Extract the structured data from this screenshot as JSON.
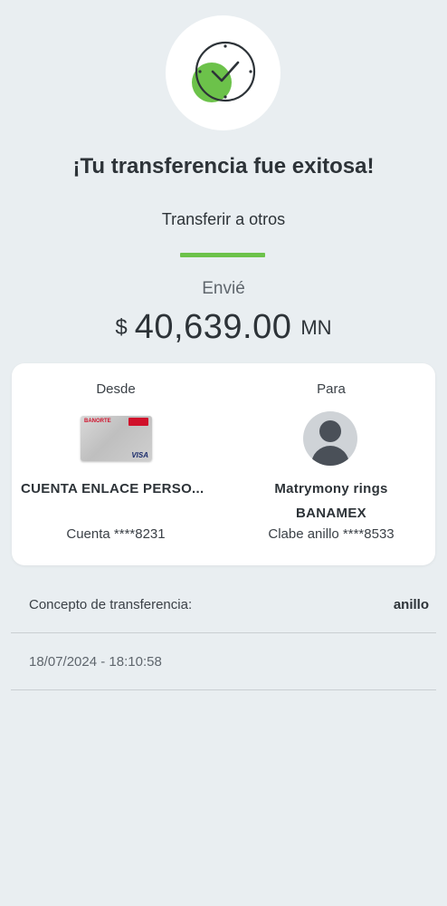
{
  "header": {
    "title": "¡Tu transferencia fue exitosa!",
    "subtitle": "Transferir a otros",
    "status_icon": "clock-check-icon",
    "accent_color": "#6cc24a"
  },
  "amount": {
    "label": "Envié",
    "currency_symbol": "$",
    "value": "40,639.00",
    "unit": "MN"
  },
  "from": {
    "heading": "Desde",
    "card_brand": "BANORTE",
    "card_network": "VISA",
    "account_name": "CUENTA ENLACE PERSO...",
    "account_number": "Cuenta ****8231"
  },
  "to": {
    "heading": "Para",
    "avatar_icon": "user-avatar-icon",
    "name": "Matrymony rings",
    "bank": "BANAMEX",
    "account_number": "Clabe anillo ****8533"
  },
  "concept": {
    "label": "Concepto de transferencia:",
    "value": "anillo"
  },
  "timestamp": "18/07/2024 - 18:10:58"
}
